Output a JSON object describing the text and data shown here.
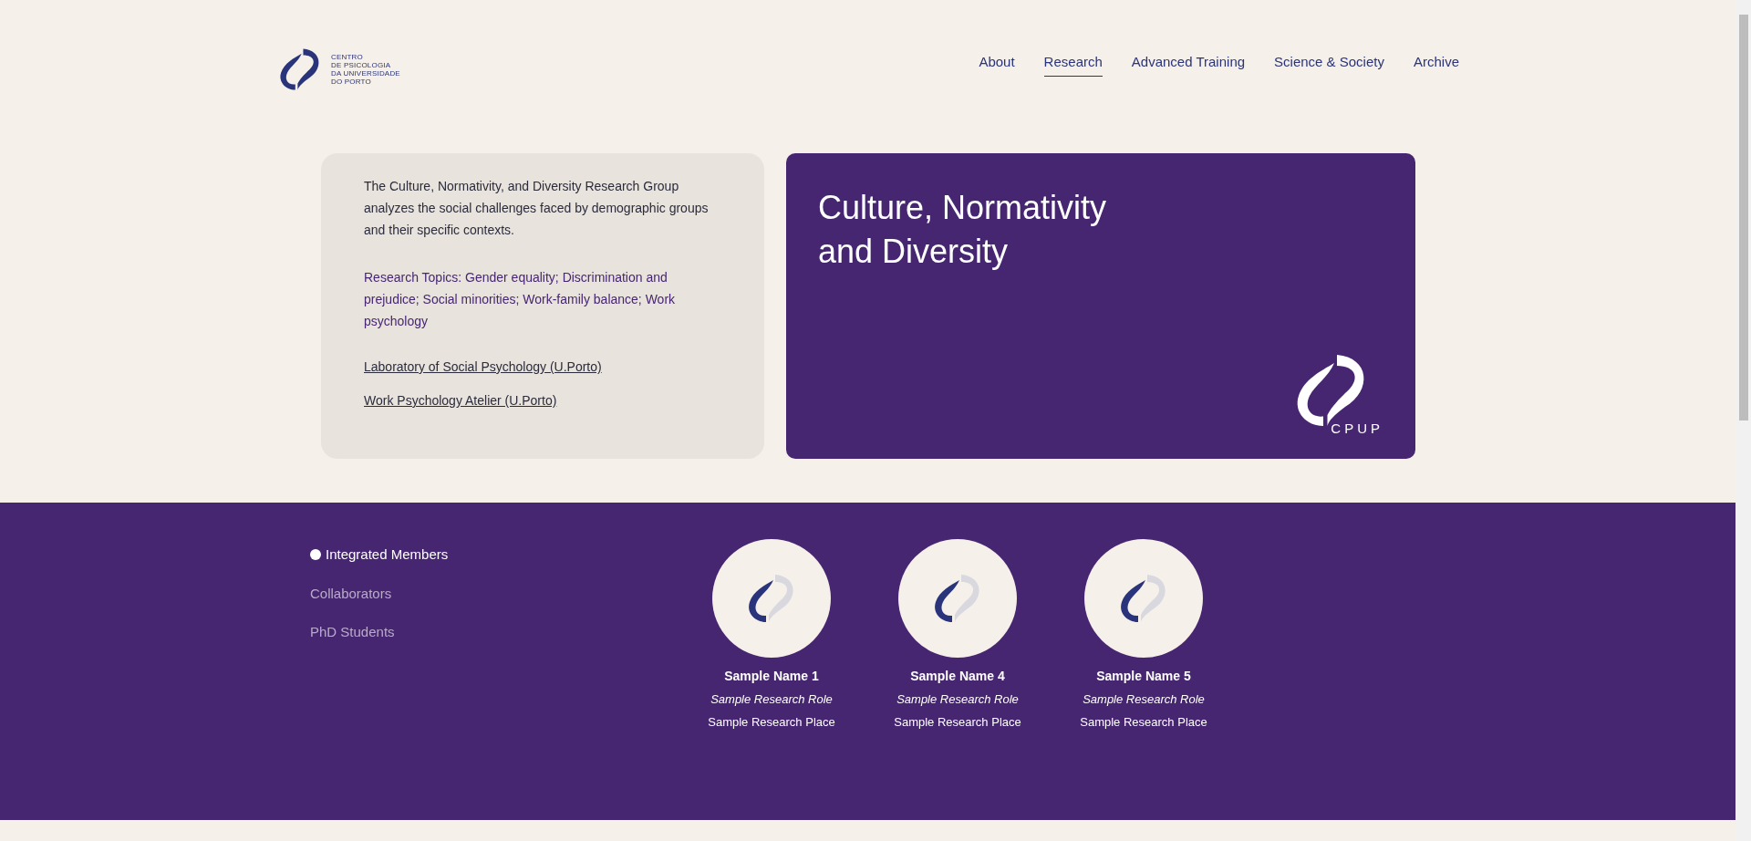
{
  "header": {
    "logo_text": [
      "CENTRO",
      "DE PSICOLOGIA",
      "DA UNIVERSIDADE",
      "DO PORTO"
    ],
    "nav": [
      {
        "label": "About",
        "selected": false
      },
      {
        "label": "Research",
        "selected": true
      },
      {
        "label": "Advanced Training",
        "selected": false
      },
      {
        "label": "Science & Society",
        "selected": false
      },
      {
        "label": "Archive",
        "selected": false
      }
    ]
  },
  "intro": {
    "description": "The Culture, Normativity, and Diversity Research Group analyzes the social challenges faced by demographic groups and their specific contexts.",
    "topics": "Research Topics: Gender equality; Discrimination and prejudice; Social minorities; Work-family balance; Work psychology",
    "links": [
      "Laboratory of Social Psychology (U.Porto)",
      "Work Psychology Atelier (U.Porto)"
    ]
  },
  "banner": {
    "title_lines": [
      "Culture, Normativity",
      "and Diversity"
    ],
    "logo_text": "CPUP"
  },
  "members": {
    "tabs": [
      {
        "label": "Integrated Members",
        "selected": true
      },
      {
        "label": "Collaborators",
        "selected": false
      },
      {
        "label": "PhD Students",
        "selected": false
      }
    ],
    "people": [
      {
        "name": "Sample Name 1",
        "role": "Sample Research Role",
        "place": "Sample Research Place"
      },
      {
        "name": "Sample Name 4",
        "role": "Sample Research Role",
        "place": "Sample Research Place"
      },
      {
        "name": "Sample Name 5",
        "role": "Sample Research Role",
        "place": "Sample Research Place"
      }
    ]
  }
}
